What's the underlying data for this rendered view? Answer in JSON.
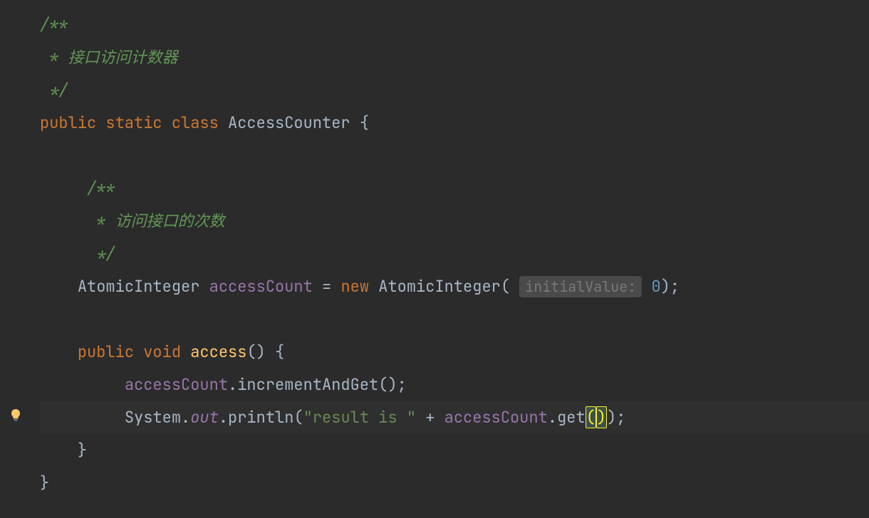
{
  "comments": {
    "class_comment_open": "/**",
    "class_comment_body": " * 接口访问计数器",
    "class_comment_close": " */",
    "field_comment_open": "/**",
    "field_comment_body": " * 访问接口的次数",
    "field_comment_close": " */"
  },
  "keywords": {
    "public": "public",
    "static": "static",
    "class": "class",
    "void": "void",
    "new": "new"
  },
  "identifiers": {
    "class_name": "AccessCounter",
    "atomic_integer": "AtomicInteger",
    "access_count": "accessCount",
    "method_access": "access",
    "increment_and_get": "incrementAndGet",
    "system": "System",
    "out": "out",
    "println": "println",
    "get": "get"
  },
  "hints": {
    "initial_value": "initialValue:"
  },
  "literals": {
    "zero": "0",
    "result_string": "\"result is \""
  },
  "punctuation": {
    "open_brace": "{",
    "close_brace": "}",
    "open_paren": "(",
    "close_paren": ")",
    "semicolon": ";",
    "dot": ".",
    "equals": "=",
    "plus": "+",
    "comma": ","
  }
}
